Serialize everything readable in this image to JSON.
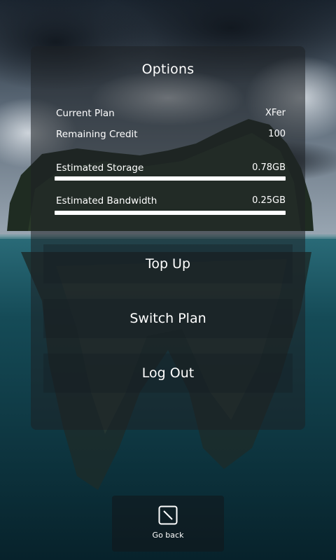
{
  "options": {
    "title": "Options",
    "current_plan_label": "Current Plan",
    "current_plan_value": "XFer",
    "remaining_credit_label": "Remaining Credit",
    "remaining_credit_value": "100",
    "estimated_storage_label": "Estimated Storage",
    "estimated_storage_value": "0.78GB",
    "estimated_storage_fill": 1.0,
    "estimated_bandwidth_label": "Estimated Bandwidth",
    "estimated_bandwidth_value": "0.25GB",
    "estimated_bandwidth_fill": 1.0
  },
  "buttons": {
    "top_up": "Top Up",
    "switch_plan": "Switch Plan",
    "log_out": "Log Out"
  },
  "footer": {
    "go_back_label": "Go back",
    "go_back_icon": "back-arrow-icon"
  },
  "colors": {
    "text": "#ffffff",
    "bar_fill": "#ffffff",
    "water": "#0f3d47"
  }
}
